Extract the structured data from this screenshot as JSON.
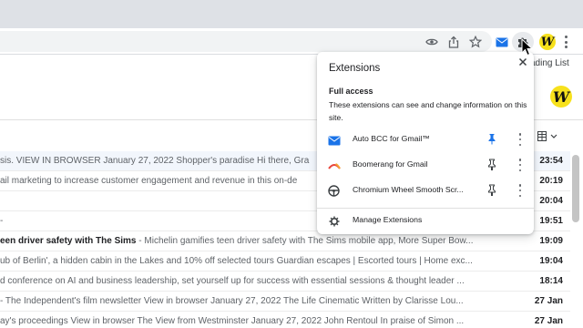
{
  "browser": {
    "toolbar_icons": [
      "eye-icon",
      "share-icon",
      "star-icon",
      "auto-bcc-icon",
      "extensions-puzzle-icon",
      "wisestamp-w-icon",
      "chrome-menu-icon"
    ],
    "extension_logo_letter": "W",
    "reading_list": "ading List"
  },
  "gmail": {
    "logo_letter": "W",
    "rows": [
      {
        "snippet_bold": "",
        "snippet": "sis. VIEW IN BROWSER January 27, 2022 Shopper's paradise Hi there, Gra",
        "time": "23:54",
        "selected": true
      },
      {
        "snippet_bold": "",
        "snippet": "ail marketing to increase customer engagement and revenue in this on-de",
        "time": "20:19",
        "selected": false
      },
      {
        "snippet_bold": "",
        "snippet": "",
        "time": "20:04",
        "selected": false
      },
      {
        "snippet_bold": "",
        "snippet": "-",
        "time": "19:51",
        "selected": false
      },
      {
        "snippet_bold": "een driver safety with The Sims",
        "snippet": " - Michelin gamifies teen driver safety with The Sims mobile app, More Super Bow...",
        "time": "19:09",
        "selected": false
      },
      {
        "snippet_bold": "",
        "snippet": "ub of Berlin', a hidden cabin in the Lakes and 10% off selected tours Guardian escapes | Escorted tours | Home exc...",
        "time": "19:04",
        "selected": false
      },
      {
        "snippet_bold": "",
        "snippet": "d conference on AI and business leadership, set yourself up for success with essential sessions & thought leader ...",
        "time": "18:14",
        "selected": false
      },
      {
        "snippet_bold": "",
        "snippet": "- The Independent's film newsletter View in browser January 27, 2022 The Life Cinematic Written by Clarisse Lou...",
        "time": "27 Jan",
        "selected": false
      },
      {
        "snippet_bold": "",
        "snippet": "ay's proceedings View in browser The View from Westminster January 27, 2022 John Rentoul In praise of Simon ...",
        "time": "27 Jan",
        "selected": false
      }
    ]
  },
  "extensions_popup": {
    "title": "Extensions",
    "full_access_label": "Full access",
    "full_access_description": "These extensions can see and change information on this site.",
    "extensions": [
      {
        "name": "Auto BCC for Gmail™",
        "icon": "envelope-icon",
        "pinned": true,
        "icon_color": "#1a73e8"
      },
      {
        "name": "Boomerang for Gmail",
        "icon": "boomerang-icon",
        "pinned": false,
        "icon_color": "#e8453c"
      },
      {
        "name": "Chromium Wheel Smooth Scr...",
        "icon": "wheel-icon",
        "pinned": false,
        "icon_color": "#3c4043"
      }
    ],
    "manage_label": "Manage Extensions"
  },
  "colors": {
    "accent_blue": "#1a73e8",
    "wisestamp_yellow": "#f7e11c",
    "tabstrip": "#dee1e6"
  }
}
